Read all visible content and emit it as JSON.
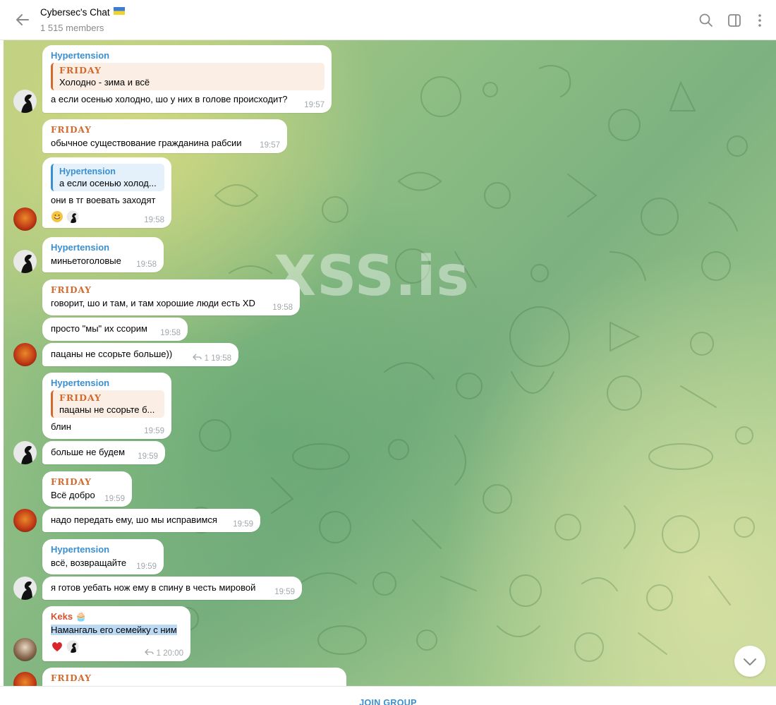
{
  "header": {
    "title": "Cybersec's Chat",
    "members": "1 515 members"
  },
  "watermark": "XSS.is",
  "messages": [
    {
      "sender": "Hypertension",
      "quote_sender": "FRIDAY",
      "quote_text": "Холодно - зима и всё",
      "text": "а если осенью холодно, шо у них в голове происходит?",
      "time": "19:57"
    },
    {
      "sender": "FRIDAY",
      "text": "обычное существование гражданина рабсии",
      "time": "19:57"
    },
    {
      "quote_sender": "Hypertension",
      "quote_text": "а если осенью холод...",
      "text": "они в тг воевать заходят",
      "time": "19:58"
    },
    {
      "sender": "Hypertension",
      "text": "миньетоголовые",
      "time": "19:58"
    },
    {
      "sender": "FRIDAY",
      "text": "говорит, шо и там, и там хорошие люди есть XD",
      "time": "19:58"
    },
    {
      "text": "просто \"мы\" их ссорим",
      "time": "19:58"
    },
    {
      "text": "пацаны не ссорьте больше))",
      "replies": "1",
      "time": "19:58"
    },
    {
      "sender": "Hypertension",
      "quote_sender": "FRIDAY",
      "quote_text": "пацаны не ссорьте б...",
      "text": "блин",
      "time": "19:59"
    },
    {
      "text": "больше не будем",
      "time": "19:59"
    },
    {
      "sender": "FRIDAY",
      "text": "Всё добро",
      "time": "19:59"
    },
    {
      "text": "надо передать ему, шо мы исправимся",
      "time": "19:59"
    },
    {
      "sender": "Hypertension",
      "text": "всё, возвращайте",
      "time": "19:59"
    },
    {
      "text": "я готов уебать нож ему в спину в честь мировой",
      "time": "19:59"
    },
    {
      "sender": "Keks",
      "sender_emoji": "🧁",
      "text": "Намангаль его семейку с ним",
      "replies": "1",
      "time": "20:00"
    },
    {
      "sender": "FRIDAY"
    }
  ],
  "footer": {
    "join_label": "JOIN GROUP"
  },
  "colors": {
    "accent": "#3a8fd1",
    "friday": "#d06a2e",
    "keks": "#d9502e"
  },
  "icons": [
    "back-arrow-icon",
    "search-icon",
    "sidebar-toggle-icon",
    "more-vertical-icon",
    "reply-arrow-icon",
    "chevron-down-icon"
  ]
}
